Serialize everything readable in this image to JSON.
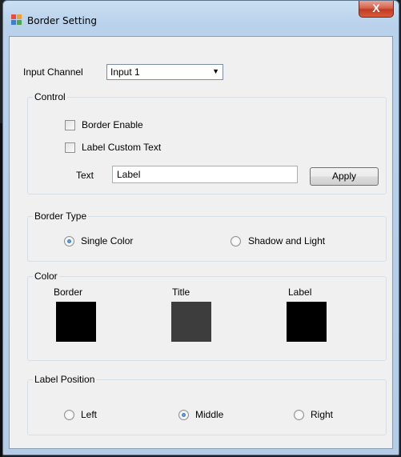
{
  "window": {
    "title": "Border Setting",
    "close_label": "X"
  },
  "input_channel": {
    "label": "Input Channel",
    "value": "Input 1"
  },
  "control": {
    "title": "Control",
    "border_enable": {
      "label": "Border Enable",
      "checked": false
    },
    "label_custom_text": {
      "label": "Label Custom Text",
      "checked": false
    },
    "text_label": "Text",
    "text_value": "Label",
    "apply_label": "Apply"
  },
  "border_type": {
    "title": "Border Type",
    "options": [
      {
        "label": "Single Color",
        "checked": true
      },
      {
        "label": "Shadow and Light",
        "checked": false
      }
    ]
  },
  "color": {
    "title": "Color",
    "items": [
      {
        "label": "Border",
        "color": "#000000"
      },
      {
        "label": "Title",
        "color": "#3d3d3d"
      },
      {
        "label": "Label",
        "color": "#000000"
      }
    ]
  },
  "label_position": {
    "title": "Label Position",
    "options": [
      {
        "label": "Left",
        "checked": false
      },
      {
        "label": "Middle",
        "checked": true
      },
      {
        "label": "Right",
        "checked": false
      }
    ]
  }
}
